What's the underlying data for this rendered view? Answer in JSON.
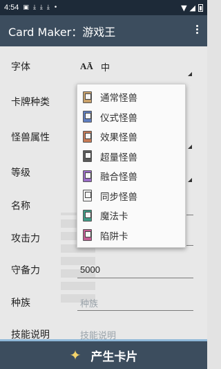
{
  "status_bar": {
    "time": "4:54",
    "icons": [
      "image-icon",
      "download-icon",
      "download-icon",
      "download-icon",
      "dot-icon"
    ],
    "right_icons": [
      "wifi-icon",
      "signal-icon",
      "battery-icon"
    ]
  },
  "app_bar": {
    "title": "Card Maker：游戏王",
    "menu_icon": "overflow-menu-icon"
  },
  "form": {
    "font": {
      "label": "字体",
      "value": "中",
      "icon": "AĀ"
    },
    "card_type": {
      "label": "卡牌种类"
    },
    "attribute": {
      "label": "怪兽属性"
    },
    "level": {
      "label": "等级"
    },
    "name": {
      "label": "名称"
    },
    "attack": {
      "label": "攻击力"
    },
    "defense": {
      "label": "守备力",
      "value": "5000"
    },
    "race": {
      "label": "种族",
      "placeholder": "种族"
    },
    "description": {
      "label": "技能说明",
      "placeholder": "技能说明"
    }
  },
  "dropdown": {
    "items": [
      {
        "label": "通常怪兽",
        "color": "#c9a16a"
      },
      {
        "label": "仪式怪兽",
        "color": "#5f7fc2"
      },
      {
        "label": "效果怪兽",
        "color": "#c77a55"
      },
      {
        "label": "超量怪兽",
        "color": "#5a5a5a"
      },
      {
        "label": "融合怪兽",
        "color": "#9a6cc6"
      },
      {
        "label": "同步怪兽",
        "color": "#f2f2f2"
      },
      {
        "label": "魔法卡",
        "color": "#3f9b86"
      },
      {
        "label": "陷阱卡",
        "color": "#c25b93"
      }
    ]
  },
  "bottom": {
    "label": "产生卡片",
    "icon": "magic-wand-icon"
  },
  "colors": {
    "app_bar": "#3c4d5e",
    "status_bar": "#1d2a38",
    "accent": "#8fb8d8"
  }
}
